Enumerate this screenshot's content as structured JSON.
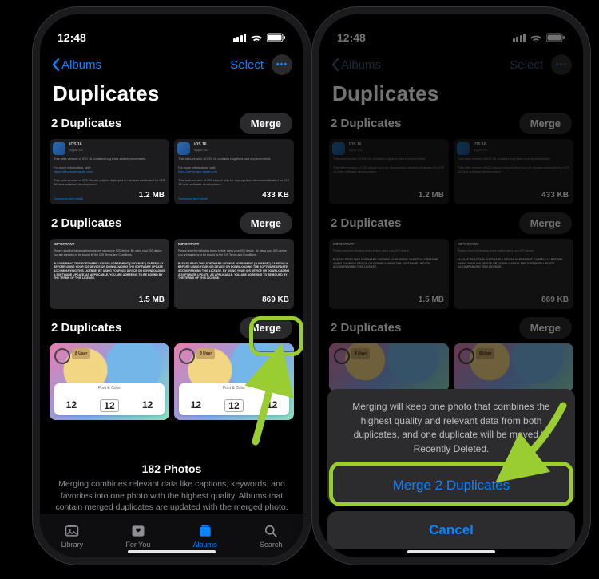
{
  "status": {
    "time": "12:48"
  },
  "nav": {
    "back_label": "Albums",
    "select_label": "Select",
    "title": "Duplicates"
  },
  "groups": [
    {
      "label": "2 Duplicates",
      "merge_label": "Merge",
      "thumbs": [
        {
          "size": "1.2 MB",
          "link": "Download and install"
        },
        {
          "size": "433 KB",
          "link": "Download and install"
        }
      ]
    },
    {
      "label": "2 Duplicates",
      "merge_label": "Merge",
      "thumbs": [
        {
          "size": "1.5 MB",
          "hd": "IMPORTANT"
        },
        {
          "size": "869 KB",
          "hd": "IMPORTANT"
        }
      ]
    },
    {
      "label": "2 Duplicates",
      "merge_label": "Merge",
      "thumbs": [
        {
          "panel_label": "Font & Color",
          "num": "12"
        },
        {
          "panel_label": "Font & Color",
          "num": "12"
        }
      ]
    }
  ],
  "footer": {
    "count": "182 Photos",
    "desc": "Merging combines relevant data like captions, keywords, and favorites into one photo with the highest quality. Albums that contain merged duplicates are updated with the merged photo."
  },
  "tabs": {
    "library": "Library",
    "foryou": "For You",
    "albums": "Albums",
    "search": "Search"
  },
  "sheet": {
    "message": "Merging will keep one photo that combines the highest quality and relevant data from both duplicates, and one duplicate will be moved to Recently Deleted.",
    "action": "Merge 2 Duplicates",
    "cancel": "Cancel"
  }
}
